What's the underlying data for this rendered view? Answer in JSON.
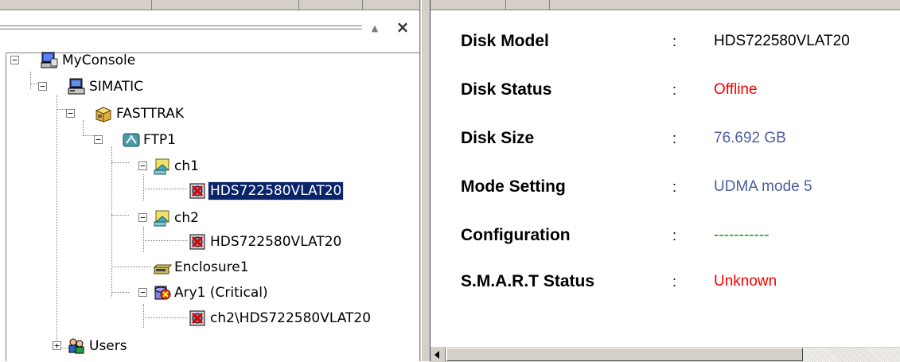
{
  "tree": {
    "nodes": [
      {
        "id": "console",
        "label": "MyConsole",
        "icon": "console-computer-icon",
        "expander": "−"
      },
      {
        "id": "simatic",
        "label": "SIMATIC",
        "icon": "computer-icon",
        "expander": "−"
      },
      {
        "id": "fasttrak",
        "label": "FASTTRAK",
        "icon": "controller-card-icon",
        "expander": "−"
      },
      {
        "id": "ftp1",
        "label": "FTP1",
        "icon": "adapter-icon",
        "expander": "−"
      },
      {
        "id": "ch1",
        "label": "ch1",
        "icon": "channel-icon",
        "expander": "−"
      },
      {
        "id": "disk1",
        "label": "HDS722580VLAT20",
        "icon": "disk-error-icon",
        "selected": true
      },
      {
        "id": "ch2",
        "label": "ch2",
        "icon": "channel-icon",
        "expander": "−"
      },
      {
        "id": "disk2",
        "label": "HDS722580VLAT20",
        "icon": "disk-error-icon"
      },
      {
        "id": "enclosure",
        "label": "Enclosure1",
        "icon": "enclosure-icon"
      },
      {
        "id": "ary1",
        "label": "Ary1 (Critical)",
        "icon": "array-critical-icon",
        "expander": "−"
      },
      {
        "id": "arydisk",
        "label": "ch2\\HDS722580VLAT20",
        "icon": "disk-error-icon"
      },
      {
        "id": "users",
        "label": "Users",
        "icon": "users-icon",
        "expander": "+"
      }
    ],
    "pin_glyph": "▲",
    "close_glyph": "×"
  },
  "details": {
    "rows": [
      {
        "label": "Disk Model",
        "sep": ":",
        "value": "HDS722580VLAT20",
        "color": "#000000"
      },
      {
        "label": "Disk Status",
        "sep": ":",
        "value": "Offline",
        "color": "#ff0000"
      },
      {
        "label": "Disk Size",
        "sep": ":",
        "value": "76.692 GB",
        "color": "#4a5fa0"
      },
      {
        "label": "Mode Setting",
        "sep": ":",
        "value": "UDMA mode 5",
        "color": "#4a5fa0"
      },
      {
        "label": "Configuration",
        "sep": ":",
        "value": "-----------",
        "color": "#00a000"
      },
      {
        "label": "S.M.A.R.T Status",
        "sep": ":",
        "value": "Unknown",
        "color": "#ff0000"
      }
    ]
  },
  "colors": {
    "selection_bg": "#0a246a",
    "chrome": "#d4d0c8",
    "status_red": "#ff0000",
    "value_blue": "#4a5fa0",
    "config_green": "#00a000"
  }
}
